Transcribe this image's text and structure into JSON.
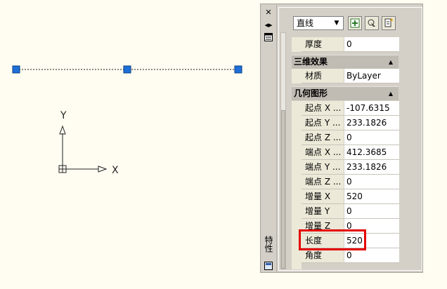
{
  "drawing": {
    "ucs_x_label": "X",
    "ucs_y_label": "Y"
  },
  "palette": {
    "title": "特性",
    "object_type": "直线",
    "sections": {
      "top_rows": [
        {
          "name": "厚度",
          "value": "0"
        }
      ],
      "view3d": {
        "title": "三维效果",
        "rows": [
          {
            "name": "材质",
            "value": "ByLayer"
          }
        ]
      },
      "geometry": {
        "title": "几何图形",
        "rows": [
          {
            "name": "起点 X ...",
            "value": "-107.6315"
          },
          {
            "name": "起点 Y ...",
            "value": "233.1826"
          },
          {
            "name": "起点 Z ...",
            "value": "0"
          },
          {
            "name": "端点 X ...",
            "value": "412.3685"
          },
          {
            "name": "端点 Y ...",
            "value": "233.1826"
          },
          {
            "name": "端点 Z ...",
            "value": "0"
          },
          {
            "name": "增量 X",
            "value": "520"
          },
          {
            "name": "增量 Y",
            "value": "0"
          },
          {
            "name": "增量 Z",
            "value": "0"
          },
          {
            "name": "长度",
            "value": "520"
          },
          {
            "name": "角度",
            "value": "0"
          }
        ]
      }
    }
  },
  "colors": {
    "canvas_bg": "#fffdf2",
    "grip_blue": "#1e6fd9",
    "highlight_red": "#e30000"
  }
}
